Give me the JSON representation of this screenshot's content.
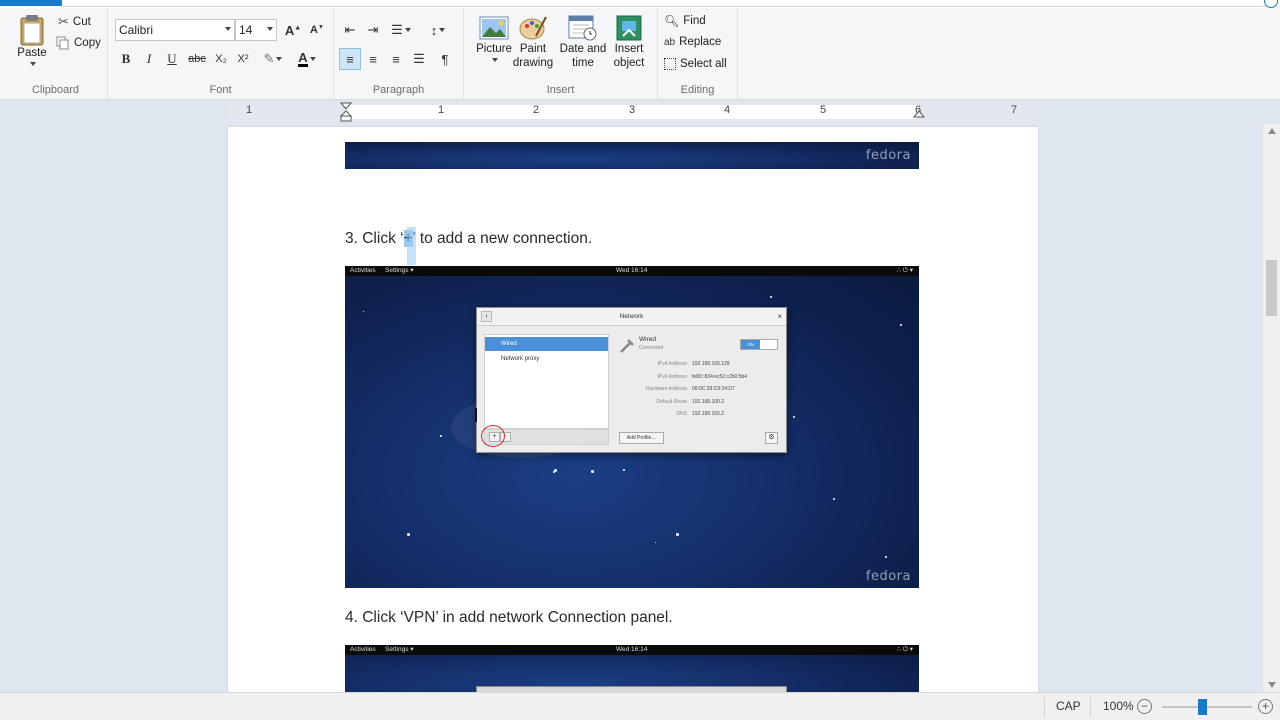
{
  "ribbon": {
    "clipboard": {
      "label": "Clipboard",
      "paste": "Paste",
      "cut": "Cut",
      "copy": "Copy"
    },
    "font": {
      "label": "Font",
      "family": "Calibri",
      "size": "14",
      "bold": "B",
      "italic": "I",
      "underline": "U",
      "strikethrough": "abc",
      "subscript": "X₂",
      "superscript": "X²"
    },
    "paragraph": {
      "label": "Paragraph"
    },
    "insert": {
      "label": "Insert",
      "picture": "Picture",
      "paint_drawing_1": "Paint",
      "paint_drawing_2": "drawing",
      "date_time_1": "Date and",
      "date_time_2": "time",
      "insert_object_1": "Insert",
      "insert_object_2": "object"
    },
    "editing": {
      "label": "Editing",
      "find": "Find",
      "replace": "Replace",
      "select_all": "Select all"
    }
  },
  "ruler": {
    "numbers": [
      "1",
      "1",
      "2",
      "3",
      "4",
      "5",
      "6",
      "7"
    ]
  },
  "document": {
    "step3_before": "3. Click ‘",
    "step3_plus": "+",
    "step3_after": "’ to add a new connection.",
    "step4": "4. Click ‘VPN’ in add network Connection panel.",
    "fedora_label": "fedora",
    "screenshot": {
      "activities": "Activities",
      "settings": "Settings ▾",
      "clock": "Wed 16:14",
      "tray": "∴  ⏻ ▾",
      "dialog_title": "Network",
      "back": "‹",
      "close": "×",
      "wired_item": "Wired",
      "proxy_item": "Network proxy",
      "wired_title": "Wired",
      "wired_status": "Connected",
      "toggle": "ON",
      "ipv4_label": "IPv4 Address",
      "ipv4_value": "192.168.100.129",
      "ipv6_label": "IPv6 Address",
      "ipv6_value": "fe80::834:ec52:c2b0:5b4",
      "hw_label": "Hardware Address",
      "hw_value": "00:0C:29:C9:24:D7",
      "route_label": "Default Route",
      "route_value": "192.168.100.2",
      "dns_label": "DNS",
      "dns_value": "192.168.100.2",
      "plus": "+",
      "minus": "−",
      "add_profile": "Add Profile…",
      "watermark": "vpn"
    }
  },
  "status": {
    "caps": "CAP",
    "zoom": "100%",
    "zoom_out": "−",
    "zoom_in": "+",
    "zoom_level": 0.45
  },
  "colors": {
    "accent": "#1979ca",
    "selection": "#99c9ef",
    "space": "#152f6a",
    "highlight_ring": "#d51a1a"
  }
}
